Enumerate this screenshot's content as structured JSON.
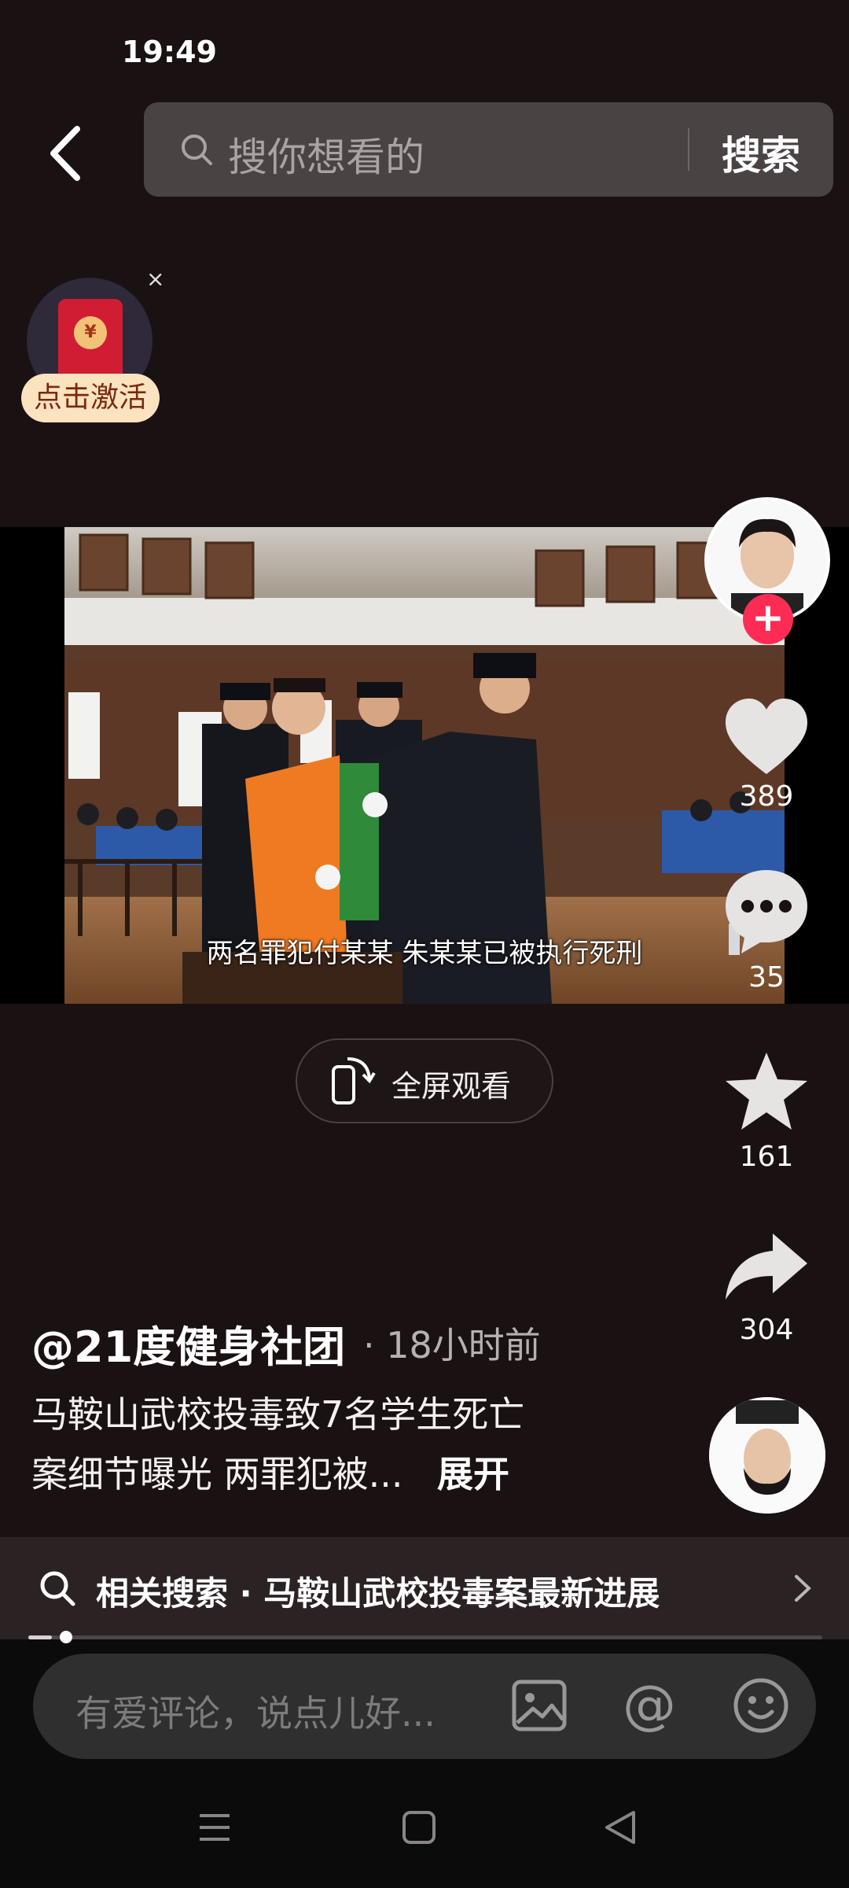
{
  "status_bar": {
    "time": "19:49"
  },
  "search": {
    "placeholder": "搜你想看的",
    "button_label": "搜索"
  },
  "red_packet": {
    "label": "点击激活",
    "close": "×",
    "coin": "¥"
  },
  "video": {
    "caption": "两名罪犯付某某 朱某某已被执行死刑"
  },
  "fullscreen": {
    "label": "全屏观看"
  },
  "actions": {
    "likes": "389",
    "comments": "35",
    "favorites": "161",
    "shares": "304",
    "follow": "+"
  },
  "post": {
    "author": "@21度健身社团",
    "time": "· 18小时前",
    "desc_line1": "马鞍山武校投毒致7名学生死亡",
    "desc_line2": "案细节曝光 两罪犯被...",
    "expand": "展开"
  },
  "related_search": {
    "text": "相关搜索 · 马鞍山武校投毒案最新进展"
  },
  "playback": {
    "progress": 0.03
  },
  "comment_input": {
    "placeholder": "有爱评论，说点儿好..."
  },
  "colors": {
    "background": "#1a1112",
    "follow_red": "#fe2c55",
    "search_bg": "#4a4344"
  }
}
